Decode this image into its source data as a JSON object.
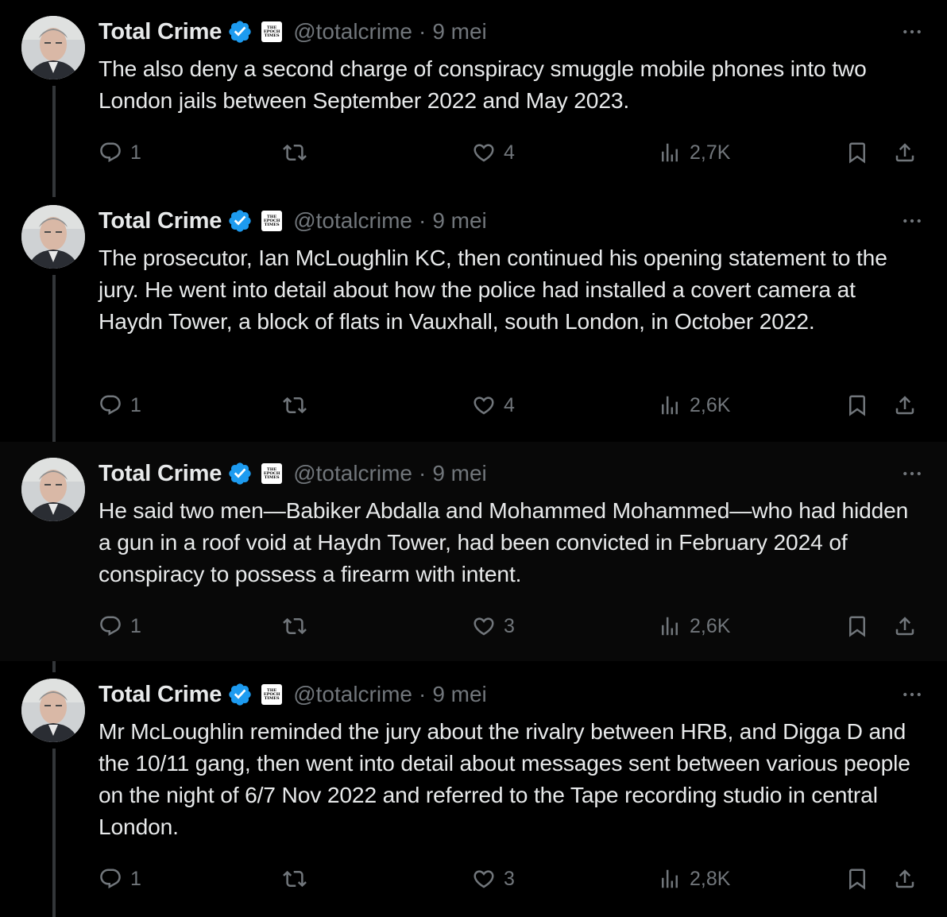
{
  "tweets": [
    {
      "name": "Total Crime",
      "badge": "THE EPOCH TIMES",
      "handle": "@totalcrime",
      "separator": "·",
      "date": "9 mei",
      "text": "The also deny a second charge of conspiracy smuggle mobile phones into two London jails between September 2022 and May 2023.",
      "replies": "1",
      "retweets": "",
      "likes": "4",
      "views": "2,7K"
    },
    {
      "name": "Total Crime",
      "badge": "THE EPOCH TIMES",
      "handle": "@totalcrime",
      "separator": "·",
      "date": "9 mei",
      "text": "The prosecutor, Ian McLoughlin KC, then continued his opening statement to the jury. He went into detail about how the police had installed a covert camera at Haydn Tower, a block of flats in Vauxhall, south London, in October 2022.",
      "replies": "1",
      "retweets": "",
      "likes": "4",
      "views": "2,6K"
    },
    {
      "name": "Total Crime",
      "badge": "THE EPOCH TIMES",
      "handle": "@totalcrime",
      "separator": "·",
      "date": "9 mei",
      "text": "He said two men—Babiker Abdalla and Mohammed Mohammed—who had hidden a gun in a roof void at Haydn Tower, had been convicted in February 2024 of conspiracy to possess a firearm with intent.",
      "replies": "1",
      "retweets": "",
      "likes": "3",
      "views": "2,6K"
    },
    {
      "name": "Total Crime",
      "badge": "THE EPOCH TIMES",
      "handle": "@totalcrime",
      "separator": "·",
      "date": "9 mei",
      "text": "Mr McLoughlin reminded the jury about the rivalry between HRB, and Digga D and the 10/11 gang, then went into detail about messages sent between various people on the night of 6/7 Nov 2022 and referred to the Tape recording studio in central London.",
      "replies": "1",
      "retweets": "",
      "likes": "3",
      "views": "2,8K"
    }
  ],
  "colors": {
    "background": "#000000",
    "hover_background": "#080808",
    "text": "#e7e9ea",
    "muted": "#71767b",
    "verified": "#1d9bf0",
    "thread_line": "#333639"
  },
  "icons": {
    "reply": "reply-icon",
    "retweet": "retweet-icon",
    "like": "heart-icon",
    "views": "views-icon",
    "bookmark": "bookmark-icon",
    "share": "share-icon",
    "more": "more-icon",
    "verified": "verified-icon"
  }
}
